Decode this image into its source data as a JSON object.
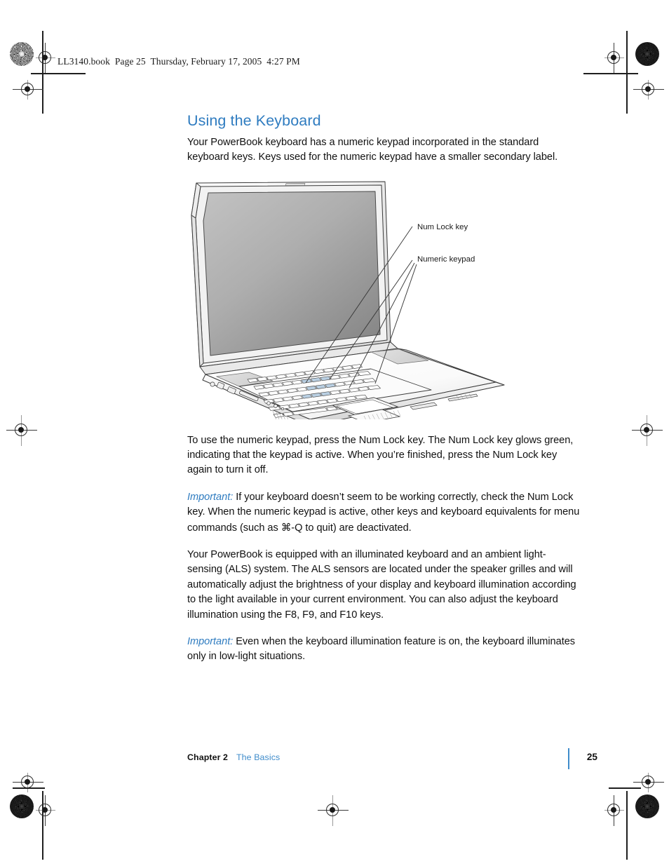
{
  "document": {
    "book_header": "LL3140.book  Page 25  Thursday, February 17, 2005  4:27 PM",
    "section_title": "Using the Keyboard",
    "intro_paragraph": "Your PowerBook keyboard has a numeric keypad incorporated in the standard keyboard keys. Keys used for the numeric keypad have a smaller secondary label.",
    "paragraph_keypad": "To use the numeric keypad, press the Num Lock key. The Num Lock key glows green, indicating that the keypad is active. When you’re finished, press the Num Lock key again to turn it off.",
    "important_label": "Important:",
    "important_1_part_a": " If your keyboard doesn’t seem to be working correctly, check the Num Lock key. When the numeric keypad is active, other keys and keyboard equivalents for menu commands (such as ",
    "important_1_command_symbol": "⌘",
    "important_1_part_b": "-Q to quit) are deactivated.",
    "paragraph_als": "Your PowerBook is equipped with an illuminated keyboard and an ambient light-sensing (ALS) system. The ALS sensors are located under the speaker grilles and will automatically adjust the brightness of your display and keyboard illumination according to the light available in your current environment. You can also adjust the keyboard illumination using the F8, F9, and F10 keys.",
    "important_2_text": " Even when the keyboard illumination feature is on, the keyboard illuminates only in low-light situations."
  },
  "figure": {
    "caption_alt": "PowerBook laptop illustration with keyboard numeric keypad highlighted",
    "callouts": [
      {
        "id": "num-lock-key",
        "label": "Num Lock key"
      },
      {
        "id": "numeric-keypad",
        "label": "Numeric keypad"
      }
    ]
  },
  "footer": {
    "chapter": "Chapter 2",
    "chapter_title": "The Basics",
    "page_number": "25"
  },
  "colors": {
    "heading_blue": "#2f7cc0",
    "footer_link_blue": "#3f8ccb",
    "body_black": "#111111",
    "key_highlight_blue": "#b9cfe2",
    "screen_gray_light": "#bcbcbc",
    "screen_gray_dark": "#8b8b8b",
    "case_gray": "#d8d8d8",
    "outline": "#3a3a3a"
  },
  "print_marks": {
    "registration_mark_count": 8,
    "rosette_count": 4
  }
}
